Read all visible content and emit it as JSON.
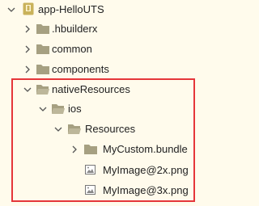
{
  "tree": {
    "root": {
      "label": "app-HelloUTS",
      "expanded": true
    },
    "items": [
      {
        "label": ".hbuilderx",
        "type": "folder",
        "expanded": false
      },
      {
        "label": "common",
        "type": "folder",
        "expanded": false
      },
      {
        "label": "components",
        "type": "folder",
        "expanded": false
      },
      {
        "label": "nativeResources",
        "type": "folder",
        "expanded": true
      },
      {
        "label": "ios",
        "type": "folder",
        "expanded": true
      },
      {
        "label": "Resources",
        "type": "folder",
        "expanded": true
      },
      {
        "label": "MyCustom.bundle",
        "type": "folder",
        "expanded": false
      },
      {
        "label": "MyImage@2x.png",
        "type": "image"
      },
      {
        "label": "MyImage@3x.png",
        "type": "image"
      }
    ]
  },
  "colors": {
    "folder": "#a6a081",
    "highlight_border": "#e5363a",
    "background": "#fffbec"
  }
}
